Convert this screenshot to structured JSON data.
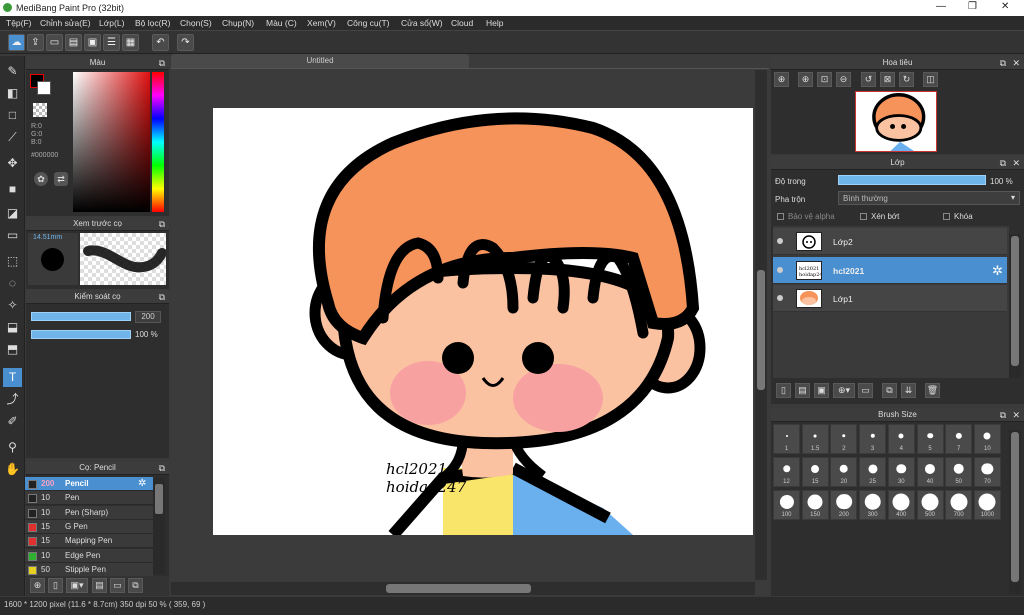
{
  "window": {
    "title": "MediBang Paint Pro (32bit)",
    "minimize": "—",
    "maximize": "❐",
    "close": "✕"
  },
  "menu": [
    "Tệp(F)",
    "Chỉnh sửa(E)",
    "Lớp(L)",
    "Bộ lọc(R)",
    "Chọn(S)",
    "Chụp(N)",
    "Màu (C)",
    "Xem(V)",
    "Công cụ(T)",
    "Cửa sổ(W)",
    "Cloud",
    "Help"
  ],
  "color_panel": {
    "title": "Màu",
    "r": "R:0",
    "g": "G:0",
    "b": "B:0",
    "hex": "#000000"
  },
  "brush_preview": {
    "title": "Xem trước cọ",
    "size": "14.51mm"
  },
  "brush_control": {
    "title": "Kiểm soát cọ",
    "size_value": "200",
    "opacity_value": "100 %",
    "opacity_fraction": 1.0
  },
  "brush_list": {
    "title": "Cọ: Pencil",
    "items": [
      {
        "size": "200",
        "name": "Pencil",
        "color": "#222222",
        "selected": true
      },
      {
        "size": "10",
        "name": "Pen",
        "color": "#222222"
      },
      {
        "size": "10",
        "name": "Pen (Sharp)",
        "color": "#222222"
      },
      {
        "size": "15",
        "name": "G Pen",
        "color": "#e03030"
      },
      {
        "size": "15",
        "name": "Mapping Pen",
        "color": "#e03030"
      },
      {
        "size": "10",
        "name": "Edge Pen",
        "color": "#30b030"
      },
      {
        "size": "50",
        "name": "Stipple Pen",
        "color": "#e8d020"
      }
    ]
  },
  "document": {
    "tab": "Untitled",
    "text_line1": "hcl2021",
    "text_line2": "hoidap247"
  },
  "navigator": {
    "title": "Hoa tiêu"
  },
  "layer_panel": {
    "title": "Lớp",
    "opacity_label": "Độ trong",
    "opacity_value": "100 %",
    "opacity_fraction": 1.0,
    "blend_label": "Pha trộn",
    "blend_value": "Bình thường",
    "protect_alpha": "Bảo vệ alpha",
    "clipping": "Xén bớt",
    "lock": "Khóa",
    "layers": [
      {
        "name": "Lớp2"
      },
      {
        "name": "hcl2021",
        "selected": true
      },
      {
        "name": "Lớp1"
      }
    ]
  },
  "brush_size": {
    "title": "Brush Size",
    "sizes": [
      "1",
      "1.5",
      "2",
      "3",
      "4",
      "5",
      "7",
      "10",
      "12",
      "15",
      "20",
      "25",
      "30",
      "40",
      "50",
      "70",
      "100",
      "150",
      "200",
      "300",
      "400",
      "500",
      "700",
      "1000"
    ]
  },
  "status": {
    "text": "1600 * 1200 pixel   (11.6 * 8.7cm)   350 dpi   50 %   ( 359, 69 )"
  },
  "colors": {
    "accent": "#4a8fd0",
    "hair": "#f5935a",
    "skin": "#fbc2a2",
    "cheek": "#f7a1a1",
    "shirt_yellow": "#f8e56a",
    "shirt_blue": "#6ab0ee"
  }
}
